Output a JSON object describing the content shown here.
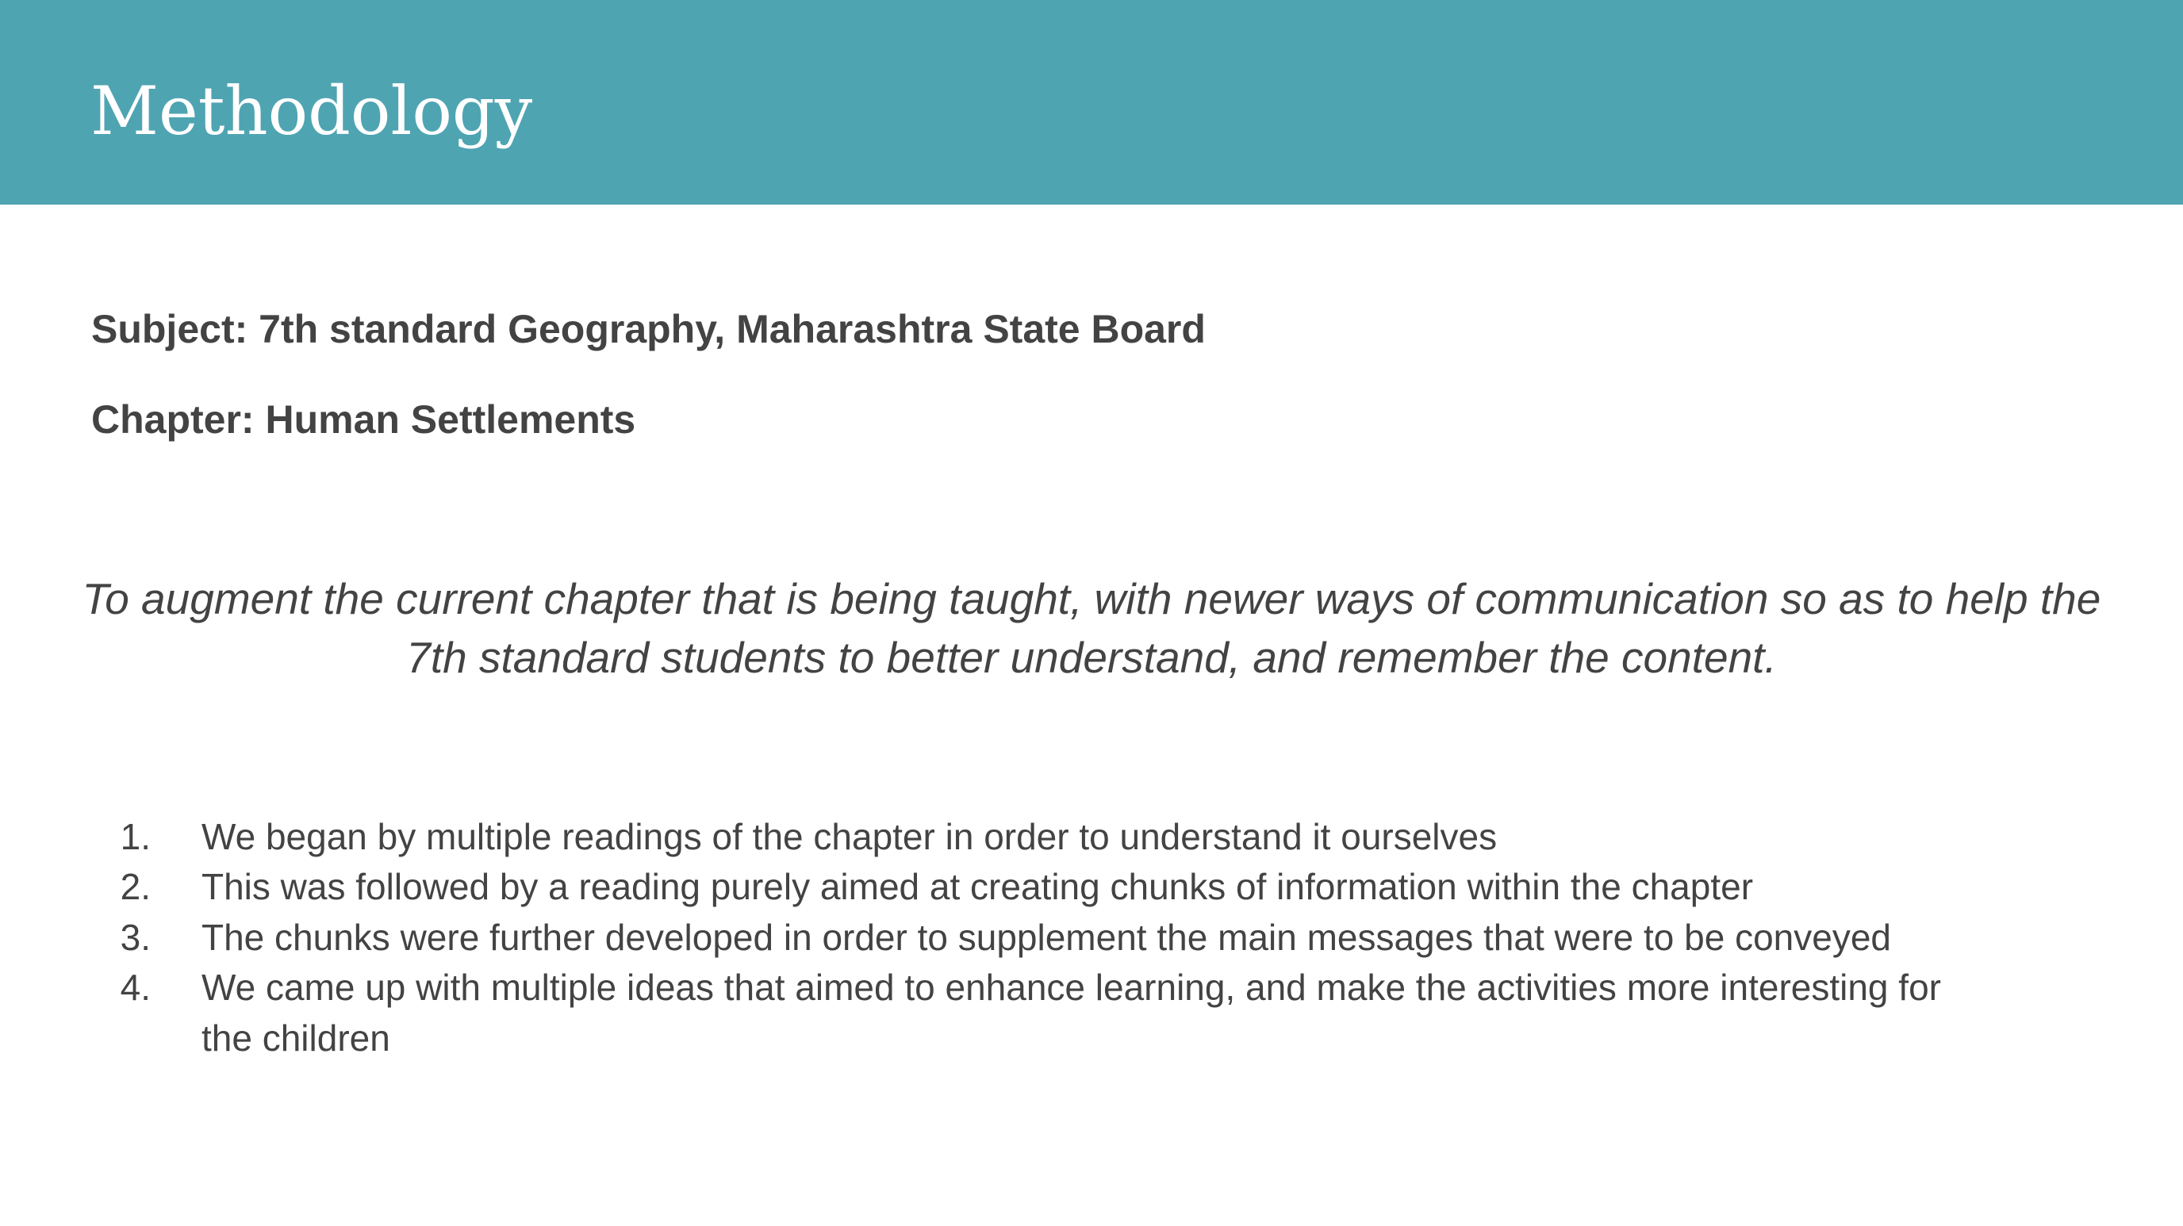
{
  "slide": {
    "title": "Methodology",
    "subject": "Subject: 7th standard Geography, Maharashtra State Board",
    "chapter": "Chapter: Human Settlements",
    "objective": "To augment the current chapter that is being taught, with newer ways of communication so as to help the 7th standard students to better understand, and remember the content.",
    "steps": [
      {
        "number": "1.",
        "text": "We began by multiple readings of the chapter in order to understand it ourselves"
      },
      {
        "number": "2.",
        "text": "This was followed by a reading purely aimed at creating chunks of information within the chapter"
      },
      {
        "number": "3.",
        "text": "The chunks were further developed in order to supplement the main messages that were to be conveyed"
      },
      {
        "number": "4.",
        "text": "We came up with multiple ideas that aimed to enhance learning, and make the activities more interesting for the children"
      }
    ]
  },
  "colors": {
    "header_band": "#4fa4b2",
    "title_text": "#ffffff",
    "body_text": "#434343",
    "background": "#ffffff"
  }
}
